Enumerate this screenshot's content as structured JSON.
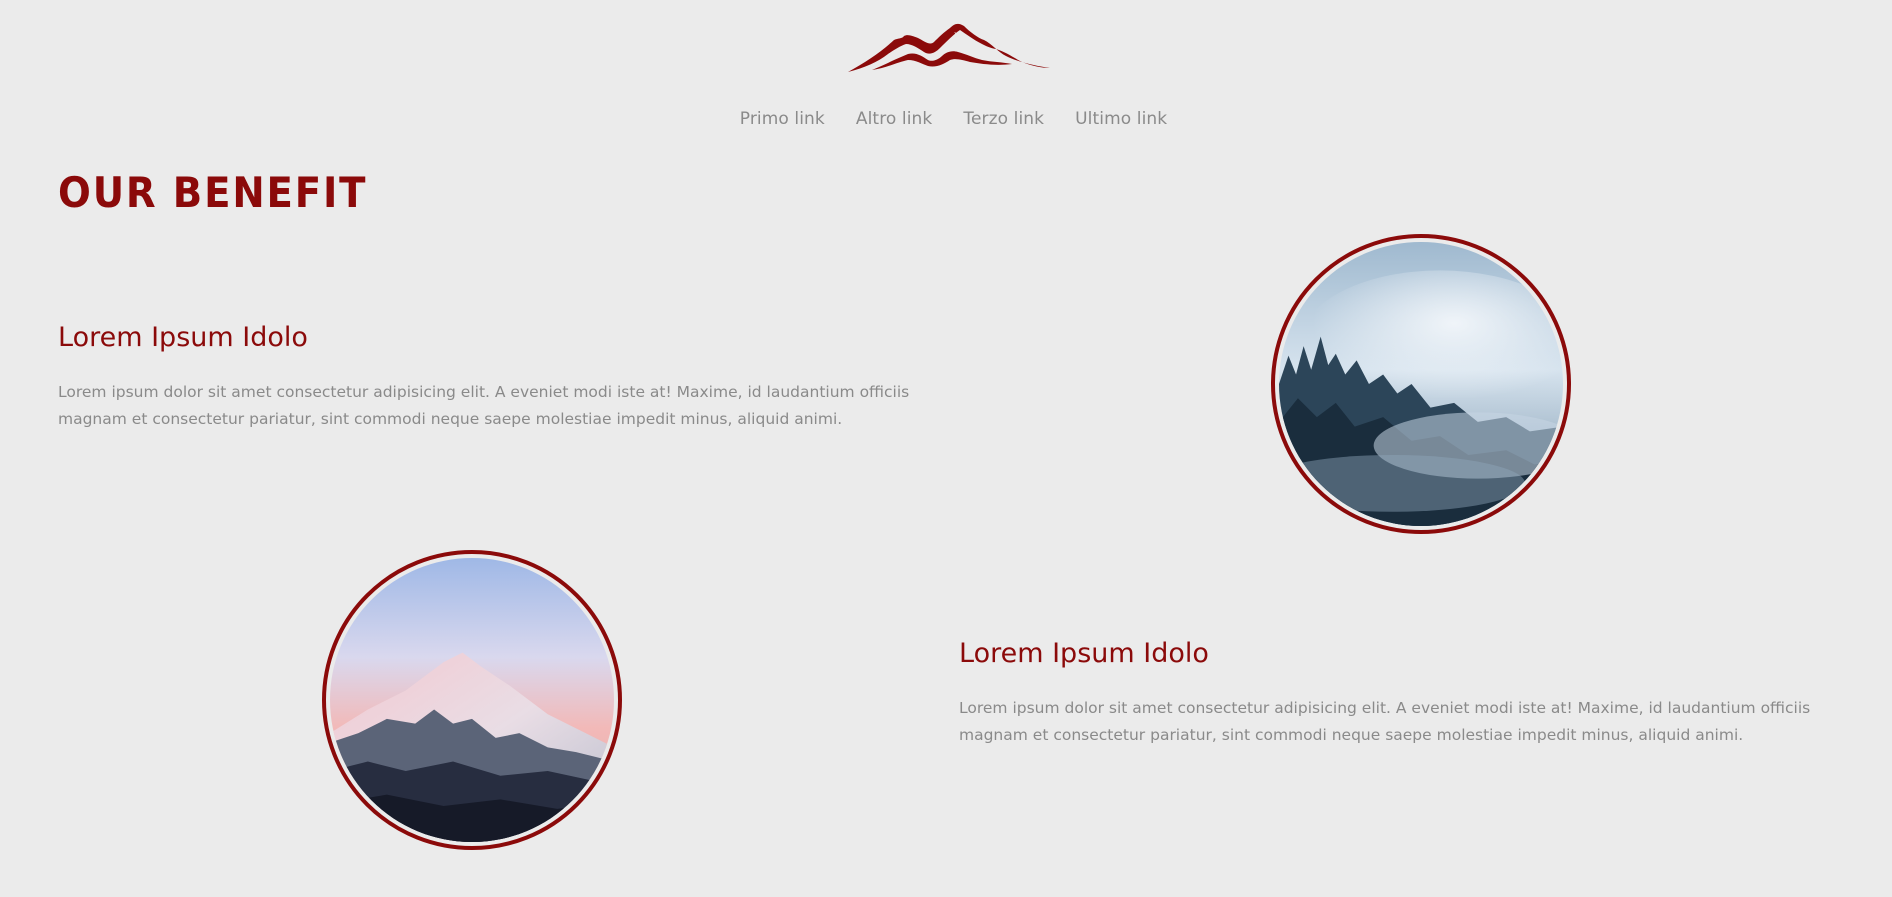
{
  "header": {
    "logo": "mountain-logo",
    "nav": [
      {
        "label": "Primo link"
      },
      {
        "label": "Altro link"
      },
      {
        "label": "Terzo link"
      },
      {
        "label": "Ultimo link"
      }
    ]
  },
  "section": {
    "title": "OUR BENEFIT"
  },
  "benefits": [
    {
      "title": "Lorem Ipsum Idolo",
      "text": "Lorem ipsum dolor sit amet consectetur adipisicing elit. A eveniet modi iste at! Maxime, id laudantium officiis magnam et consectetur pariatur, sint commodi neque saepe molestiae impedit minus, aliquid animi.",
      "image": "foggy-forest-photo"
    },
    {
      "title": "Lorem Ipsum Idolo",
      "text": "Lorem ipsum dolor sit amet consectetur adipisicing elit. A eveniet modi iste at! Maxime, id laudantium officiis magnam et consectetur pariatur, sint commodi neque saepe molestiae impedit minus, aliquid animi.",
      "image": "snowy-mountain-photo"
    }
  ],
  "colors": {
    "accent": "#8b0a0a",
    "background": "#ebebeb",
    "text_muted": "#8a8a8a"
  }
}
